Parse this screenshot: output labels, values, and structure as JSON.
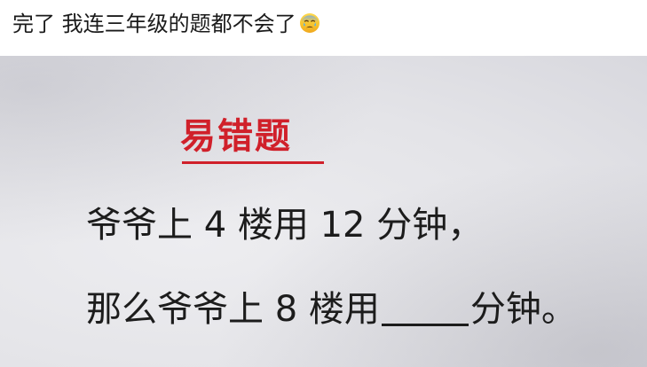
{
  "caption": {
    "text": "完了 我连三年级的题都不会了",
    "emoji_icon": "crying-face-icon"
  },
  "worksheet": {
    "title": "易错题",
    "line1": "爷爷上 4 楼用 12 分钟，",
    "line2_before": "那么爷爷上 8 楼用",
    "line2_after": "分钟。"
  },
  "colors": {
    "title_red": "#d0202a",
    "text": "#1c1c1c"
  }
}
